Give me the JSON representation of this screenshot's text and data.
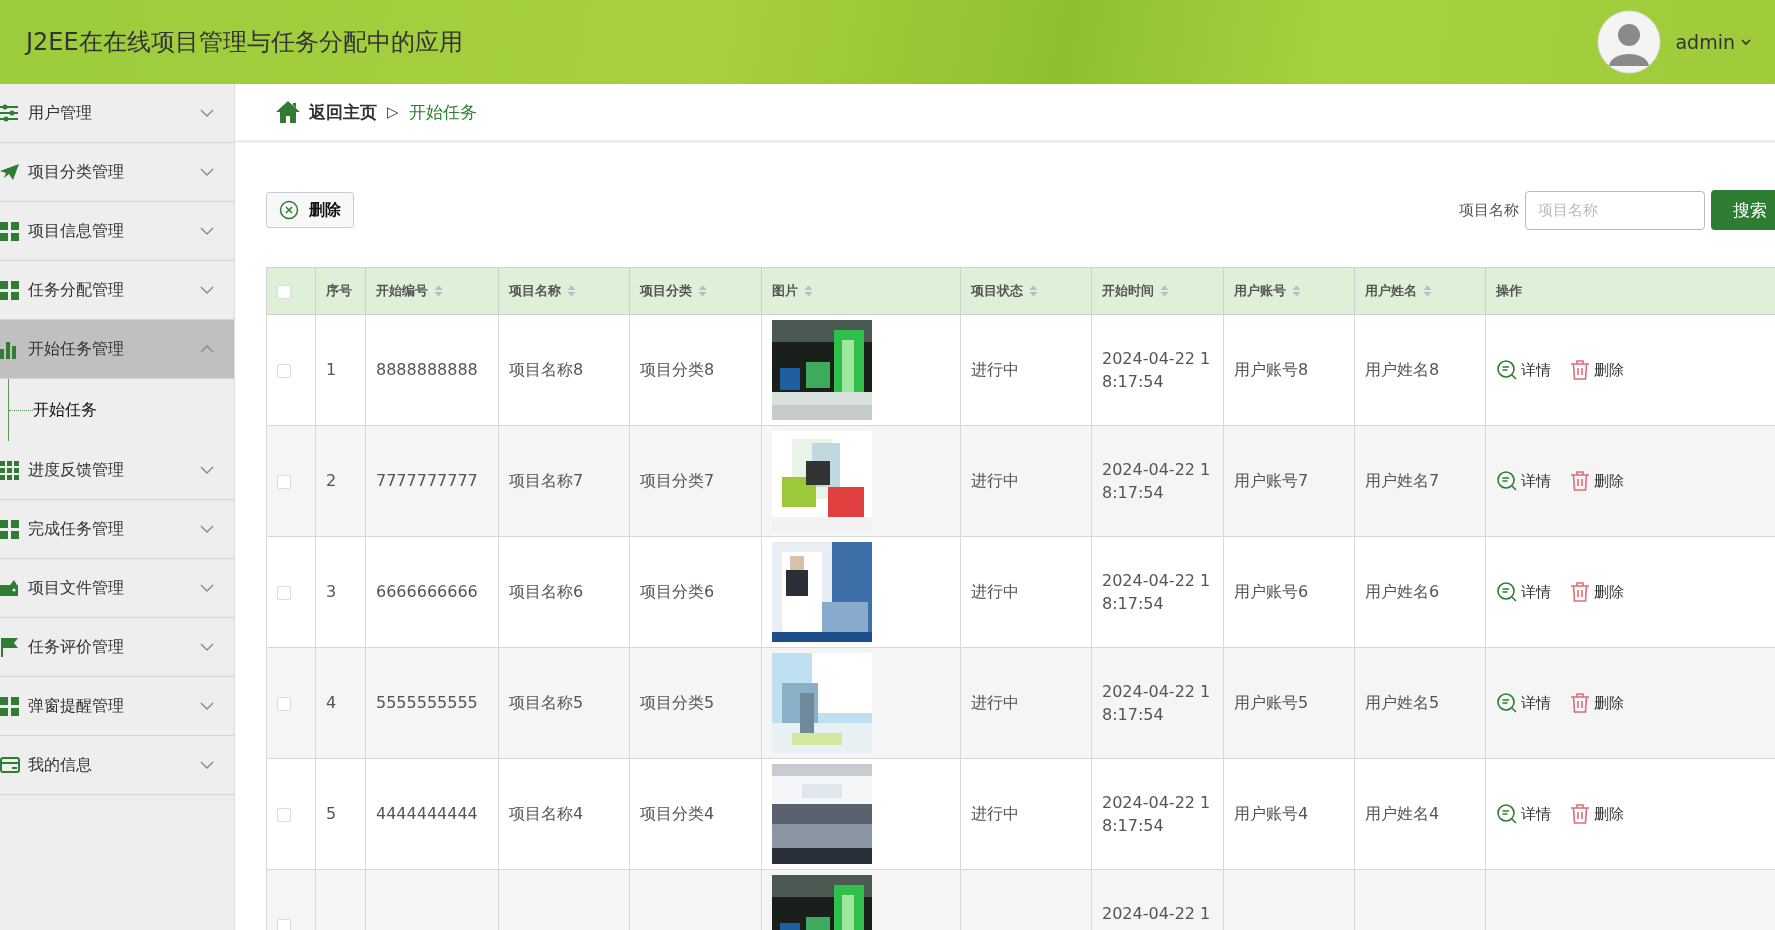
{
  "header": {
    "title": "J2EE在在线项目管理与任务分配中的应用",
    "user": "admin"
  },
  "sidebar": {
    "items": [
      {
        "label": "用户管理",
        "expanded": false,
        "selected": false
      },
      {
        "label": "项目分类管理",
        "expanded": false,
        "selected": false
      },
      {
        "label": "项目信息管理",
        "expanded": false,
        "selected": false
      },
      {
        "label": "任务分配管理",
        "expanded": false,
        "selected": false
      },
      {
        "label": "开始任务管理",
        "expanded": true,
        "selected": true,
        "children": [
          {
            "label": "开始任务"
          }
        ]
      },
      {
        "label": "进度反馈管理",
        "expanded": false,
        "selected": false
      },
      {
        "label": "完成任务管理",
        "expanded": false,
        "selected": false
      },
      {
        "label": "项目文件管理",
        "expanded": false,
        "selected": false
      },
      {
        "label": "任务评价管理",
        "expanded": false,
        "selected": false
      },
      {
        "label": "弹窗提醒管理",
        "expanded": false,
        "selected": false
      },
      {
        "label": "我的信息",
        "expanded": false,
        "selected": false
      }
    ]
  },
  "breadcrumb": {
    "home": "返回主页",
    "separator": "▷",
    "current": "开始任务"
  },
  "toolbar": {
    "delete_button": "删除",
    "search_label": "项目名称",
    "search_placeholder": "项目名称",
    "search_button": "搜索"
  },
  "table": {
    "select_all_checked": false,
    "columns": [
      {
        "label": "序号",
        "sortable": false
      },
      {
        "label": "开始编号",
        "sortable": true
      },
      {
        "label": "项目名称",
        "sortable": true
      },
      {
        "label": "项目分类",
        "sortable": true
      },
      {
        "label": "图片",
        "sortable": true
      },
      {
        "label": "项目状态",
        "sortable": true
      },
      {
        "label": "开始时间",
        "sortable": true
      },
      {
        "label": "用户账号",
        "sortable": true
      },
      {
        "label": "用户姓名",
        "sortable": true
      },
      {
        "label": "操作",
        "sortable": false
      }
    ],
    "rows": [
      {
        "checked": false,
        "index": "1",
        "code": "8888888888",
        "name": "项目名称8",
        "category": "项目分类8",
        "status": "进行中",
        "start_time": "2024-04-22 18:17:54",
        "account": "用户账号8",
        "user_name": "用户姓名8",
        "actions": [
          "详情",
          "删除"
        ]
      },
      {
        "checked": false,
        "index": "2",
        "code": "7777777777",
        "name": "项目名称7",
        "category": "项目分类7",
        "status": "进行中",
        "start_time": "2024-04-22 18:17:54",
        "account": "用户账号7",
        "user_name": "用户姓名7",
        "actions": [
          "详情",
          "删除"
        ]
      },
      {
        "checked": false,
        "index": "3",
        "code": "6666666666",
        "name": "项目名称6",
        "category": "项目分类6",
        "status": "进行中",
        "start_time": "2024-04-22 18:17:54",
        "account": "用户账号6",
        "user_name": "用户姓名6",
        "actions": [
          "详情",
          "删除"
        ]
      },
      {
        "checked": false,
        "index": "4",
        "code": "5555555555",
        "name": "项目名称5",
        "category": "项目分类5",
        "status": "进行中",
        "start_time": "2024-04-22 18:17:54",
        "account": "用户账号5",
        "user_name": "用户姓名5",
        "actions": [
          "详情",
          "删除"
        ]
      },
      {
        "checked": false,
        "index": "5",
        "code": "4444444444",
        "name": "项目名称4",
        "category": "项目分类4",
        "status": "进行中",
        "start_time": "2024-04-22 18:17:54",
        "account": "用户账号4",
        "user_name": "用户姓名4",
        "actions": [
          "详情",
          "删除"
        ]
      },
      {
        "checked": false,
        "start_time": "2024-04-22 1"
      }
    ]
  }
}
